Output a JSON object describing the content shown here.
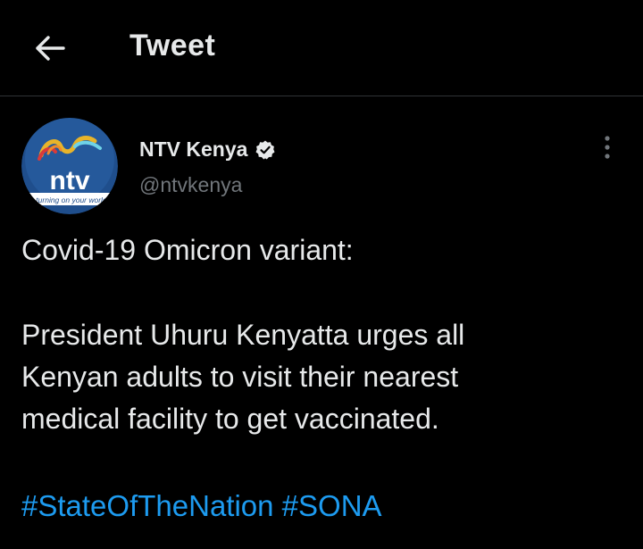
{
  "header": {
    "back_icon": "arrow-left-icon",
    "title": "Tweet"
  },
  "author": {
    "avatar_logo_text": "ntv",
    "avatar_tagline": "turning on your world",
    "display_name": "NTV Kenya",
    "verified_icon": "verified-badge-icon",
    "handle": "@ntvkenya",
    "more_icon": "more-vertical-icon"
  },
  "tweet": {
    "line1": "Covid-19 Omicron variant:",
    "paragraph2": [
      "President Uhuru Kenyatta urges all",
      "Kenyan adults to visit their nearest",
      "medical facility to get vaccinated."
    ],
    "hashtags": [
      "#StateOfTheNation",
      "#SONA"
    ]
  },
  "colors": {
    "background": "#000000",
    "text": "#e7e9ea",
    "secondary_text": "#71767b",
    "link": "#1d9bf0",
    "divider": "#2f3336"
  }
}
